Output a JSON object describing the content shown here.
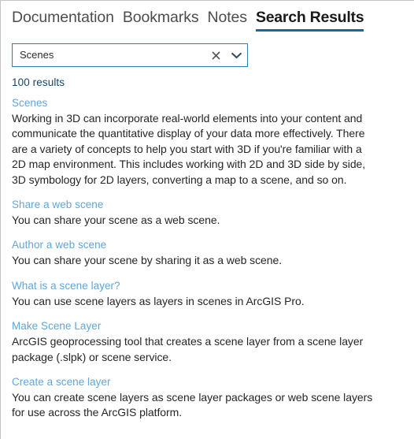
{
  "tabs": [
    {
      "label": "Documentation",
      "active": false
    },
    {
      "label": "Bookmarks",
      "active": false
    },
    {
      "label": "Notes",
      "active": false
    },
    {
      "label": "Search Results",
      "active": true
    }
  ],
  "search": {
    "value": "Scenes",
    "placeholder": "Search",
    "clear_icon": "close-x-icon",
    "dropdown_icon": "chevron-down-icon",
    "border_color": "#2b7cb5"
  },
  "results": {
    "count_label": "100 results",
    "count_color": "#16466b",
    "link_color": "#62a5d8",
    "items": [
      {
        "title": "Scenes",
        "snippet": "Working in 3D can incorporate real-world elements into your content and communicate the quantitative display of your data more effectively. There are a variety of concepts to help you start with 3D if you're familiar with a 2D map environment. This includes working with 2D and 3D side by side, 3D symbology for 2D layers, converting a map to a scene, and so on."
      },
      {
        "title": "Share a web scene",
        "snippet": "You can share your scene as a web scene."
      },
      {
        "title": "Author a web scene",
        "snippet": "You can share your scene by sharing it as a web scene."
      },
      {
        "title": "What is a scene layer?",
        "snippet": "You can use scene layers as layers in scenes in ArcGIS Pro."
      },
      {
        "title": "Make Scene Layer",
        "snippet": "ArcGIS geoprocessing tool that creates a scene layer from a scene layer package (.slpk) or scene service."
      },
      {
        "title": "Create a scene layer",
        "snippet": "You can create scene layers as scene layer packages or web scene layers for use across the ArcGIS platform."
      }
    ]
  }
}
